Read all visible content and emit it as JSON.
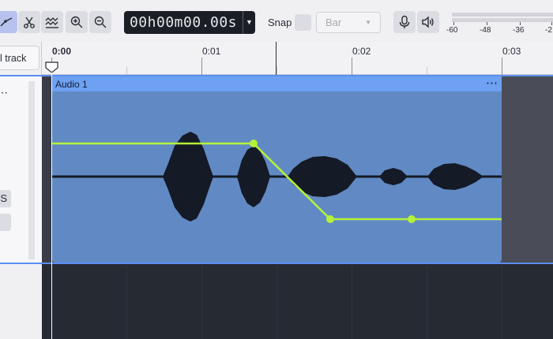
{
  "toolbar": {
    "tools": [
      {
        "name": "envelope-tool",
        "icon": "envelope-curve-icon",
        "active": true
      },
      {
        "name": "split-tool",
        "icon": "scissors-split-icon",
        "active": false
      },
      {
        "name": "multi-tool",
        "icon": "wave-multi-icon",
        "active": false
      },
      {
        "name": "zoom-in",
        "icon": "zoom-in-icon",
        "active": false
      },
      {
        "name": "zoom-out",
        "icon": "zoom-out-icon",
        "active": false
      }
    ],
    "time_display": "00h00m00.00s",
    "snap_label": "Snap",
    "snap_enabled": false,
    "snap_value": "Bar",
    "record_icon": "microphone-icon",
    "playback_icon": "speaker-icon",
    "meter_labels": [
      "-60",
      "-48",
      "-36",
      "-2"
    ]
  },
  "timeline": {
    "labels": [
      "0:00",
      "0:01",
      "0:02",
      "0:03"
    ],
    "unit_label_time_bold": true
  },
  "left_panel": {
    "add_track_label": "l track",
    "track_menu": "⋯",
    "solo_label": "S"
  },
  "track": {
    "clip_title": "Audio 1",
    "clip_menu": "⋯",
    "clip_color": "#6189c4",
    "clip_header_color": "#6ea1f2",
    "envelope_color": "#b5f23a",
    "selection_color": "#5b8ef0",
    "envelope_points": [
      {
        "time_s": 1.32,
        "gain": 1.0
      },
      {
        "time_s": 1.83,
        "gain": 0.0
      },
      {
        "time_s": 2.37,
        "gain": 0.0
      }
    ]
  }
}
